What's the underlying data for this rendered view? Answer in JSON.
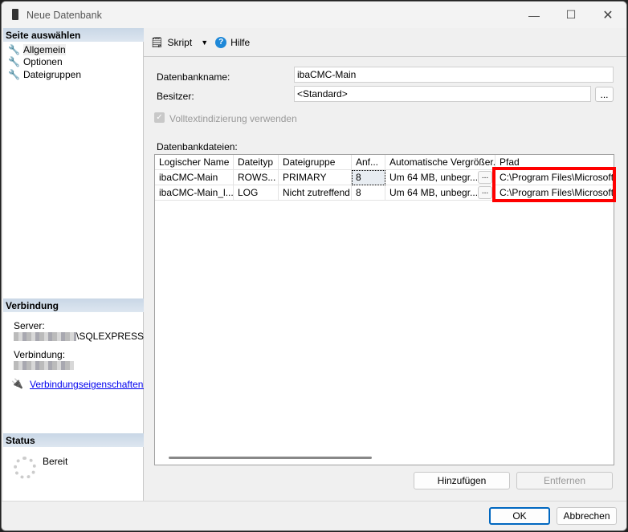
{
  "window": {
    "title": "Neue Datenbank"
  },
  "left": {
    "select_header": "Seite auswählen",
    "pages": [
      {
        "label": "Allgemein"
      },
      {
        "label": "Optionen"
      },
      {
        "label": "Dateigruppen"
      }
    ],
    "connection_header": "Verbindung",
    "server_label": "Server:",
    "server_value": "\\SQLEXPRESS",
    "connection_label": "Verbindung:",
    "link": "Verbindungseigenschaften anzeigen",
    "status_header": "Status",
    "status_value": "Bereit"
  },
  "toolbar": {
    "script": "Skript",
    "help": "Hilfe"
  },
  "form": {
    "dbname_label": "Datenbankname:",
    "dbname_value": "ibaCMC-Main",
    "owner_label": "Besitzer:",
    "owner_value": "<Standard>",
    "owner_btn": "...",
    "fulltext_label": "Volltextindizierung verwenden",
    "files_label": "Datenbankdateien:"
  },
  "grid": {
    "headers": [
      "Logischer Name",
      "Dateityp",
      "Dateigruppe",
      "Anf...",
      "Automatische Vergrößer...",
      "Pfad"
    ],
    "rows": [
      [
        "ibaCMC-Main",
        "ROWS...",
        "PRIMARY",
        "8",
        "Um 64 MB, unbegr...",
        "C:\\Program Files\\Microsoft SQ"
      ],
      [
        "ibaCMC-Main_l...",
        "LOG",
        "Nicht zutreffend",
        "8",
        "Um 64 MB, unbegr...",
        "C:\\Program Files\\Microsoft SQ"
      ]
    ],
    "cell_btn": "..."
  },
  "buttons": {
    "add": "Hinzufügen",
    "remove": "Entfernen",
    "ok": "OK",
    "cancel": "Abbrechen"
  },
  "colors": {
    "highlight": "#ff0000",
    "link": "#0000ee"
  }
}
